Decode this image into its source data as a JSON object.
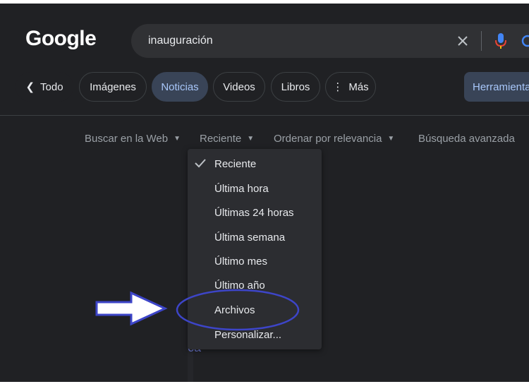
{
  "logo": "Google",
  "search": {
    "query": "inauguración",
    "icons": {
      "clear": "close-icon",
      "mic": "microphone-icon",
      "lens": "lens-icon"
    }
  },
  "chips": {
    "todo": "Todo",
    "imagenes": "Imágenes",
    "noticias": "Noticias",
    "videos": "Videos",
    "libros": "Libros",
    "mas": "Más",
    "herramientas": "Herramientas"
  },
  "tools": {
    "web": "Buscar en la Web",
    "recent": "Reciente",
    "sort": "Ordenar por relevancia",
    "advanced": "Búsqueda avanzada"
  },
  "time_menu": {
    "selected": "Reciente",
    "items": [
      "Reciente",
      "Última hora",
      "Últimas 24 horas",
      "Última semana",
      "Último mes",
      "Último año",
      "Archivos",
      "Personalizar..."
    ]
  },
  "background_text": "ca",
  "colors": {
    "background": "#202124",
    "accent_chip": "#394457",
    "accent_text": "#a8c7fa",
    "annotation": "#3d45c8",
    "mic_blue": "#4285f4",
    "mic_red": "#ea4335",
    "mic_yellow": "#fbbc05"
  }
}
